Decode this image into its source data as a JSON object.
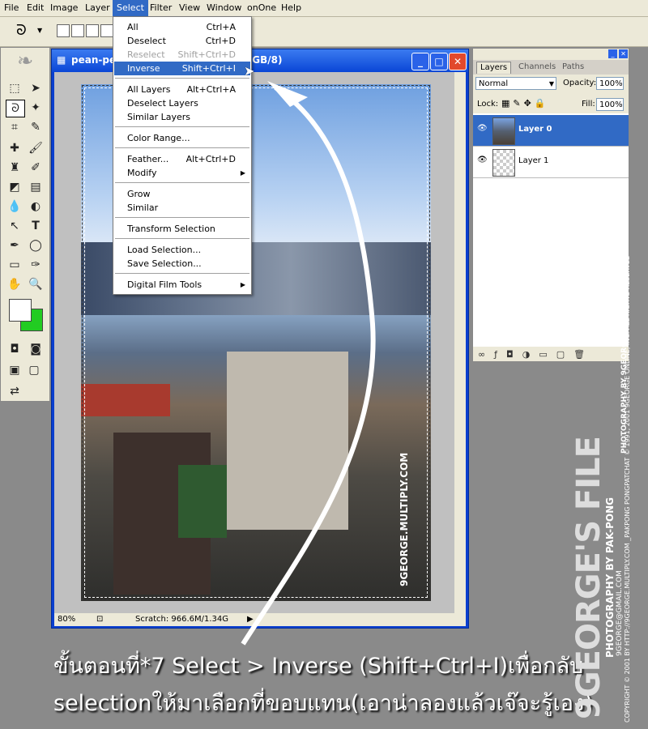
{
  "menubar": [
    "File",
    "Edit",
    "Image",
    "Layer",
    "Select",
    "Filter",
    "View",
    "Window",
    "onOne",
    "Help"
  ],
  "document": {
    "title": "pean-pe",
    "title_tail": "RGB/8)",
    "zoom": "80%",
    "scratch": "Scratch: 966.6M/1.34G",
    "watermark": "9GEORGE.MULTIPLY.COM"
  },
  "select_menu": {
    "items": [
      {
        "label": "All",
        "shortcut": "Ctrl+A"
      },
      {
        "label": "Deselect",
        "shortcut": "Ctrl+D"
      },
      {
        "label": "Reselect",
        "shortcut": "Shift+Ctrl+D"
      },
      {
        "label": "Inverse",
        "shortcut": "Shift+Ctrl+I"
      },
      {
        "label": "All Layers",
        "shortcut": "Alt+Ctrl+A"
      },
      {
        "label": "Deselect Layers",
        "shortcut": ""
      },
      {
        "label": "Similar Layers",
        "shortcut": ""
      },
      {
        "label": "Color Range...",
        "shortcut": ""
      },
      {
        "label": "Feather...",
        "shortcut": "Alt+Ctrl+D"
      },
      {
        "label": "Modify",
        "shortcut": ""
      },
      {
        "label": "Grow",
        "shortcut": ""
      },
      {
        "label": "Similar",
        "shortcut": ""
      },
      {
        "label": "Transform Selection",
        "shortcut": ""
      },
      {
        "label": "Load Selection...",
        "shortcut": ""
      },
      {
        "label": "Save Selection...",
        "shortcut": ""
      },
      {
        "label": "Digital Film Tools",
        "shortcut": ""
      }
    ]
  },
  "layers_panel": {
    "tabs": [
      "Layers",
      "Channels",
      "Paths"
    ],
    "blend_mode": "Normal",
    "opacity_label": "Opacity:",
    "opacity": "100%",
    "lock_label": "Lock:",
    "fill_label": "Fill:",
    "fill": "100%",
    "layers": [
      "Layer 0",
      "Layer 1"
    ]
  },
  "caption": {
    "line1": "ขั้นตอนที่*7 Select > Inverse (Shift+Ctrl+I)เพื่อกลับ",
    "line2": "selectionให้มาเลือกที่ขอบแทน(เอาน่าลองแล้วเจ๊จะรู้เอง)"
  },
  "credits": {
    "photo_by": "PHOTOGRAPHY BY PAK-PONG",
    "email": "9GEORGE@GMAIL.COM",
    "photo_by2": "PHOTOGRAPHY BY 9GEORGE",
    "copyright": "COPYRIGHT © 2001 BY HTTP://9GEORGE.MULTIPLY.COM _PAKPONG PONGPATCHAT © 1991, 2001 9GEORGE ONLINE, INC. ALL RIGHTS RESERVED",
    "logo": "9GEORGE'S FILE"
  },
  "colors": {
    "menu_highlight": "#316ac5",
    "fg_swatch": "#ffffff",
    "bg_swatch": "#22cc22"
  }
}
